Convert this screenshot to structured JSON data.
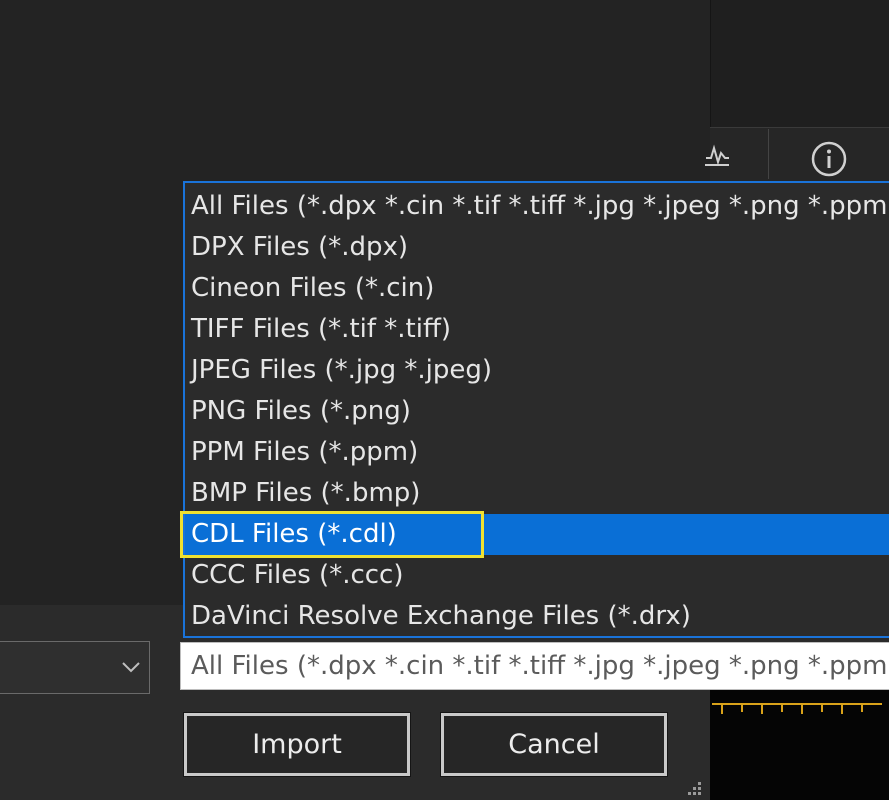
{
  "file_type_list": {
    "items": [
      "All Files (*.dpx *.cin *.tif *.tiff *.jpg *.jpeg *.png *.ppm",
      "DPX Files (*.dpx)",
      "Cineon Files (*.cin)",
      "TIFF Files (*.tif *.tiff)",
      "JPEG Files (*.jpg *.jpeg)",
      "PNG Files (*.png)",
      "PPM Files (*.ppm)",
      "BMP Files (*.bmp)",
      "CDL Files (*.cdl)",
      "CCC Files (*.ccc)",
      "DaVinci Resolve Exchange Files (*.drx)"
    ],
    "selected_index": 8
  },
  "file_type_combo": {
    "value": "All Files (*.dpx *.cin *.tif *.tiff *.jpg *.jpeg *.png *.ppm"
  },
  "buttons": {
    "import_label": "Import",
    "cancel_label": "Cancel"
  },
  "icons": {
    "toolbar": [
      "waveform-icon",
      "info-icon"
    ],
    "folder_combo": "chevron-down-icon",
    "dialog": "resize-grip-icon"
  },
  "colors": {
    "selection": "#0a6fd6",
    "list_border": "#1a73d9",
    "annotation_highlight": "#f0e130",
    "timeline_ruler": "#d9a21a"
  }
}
